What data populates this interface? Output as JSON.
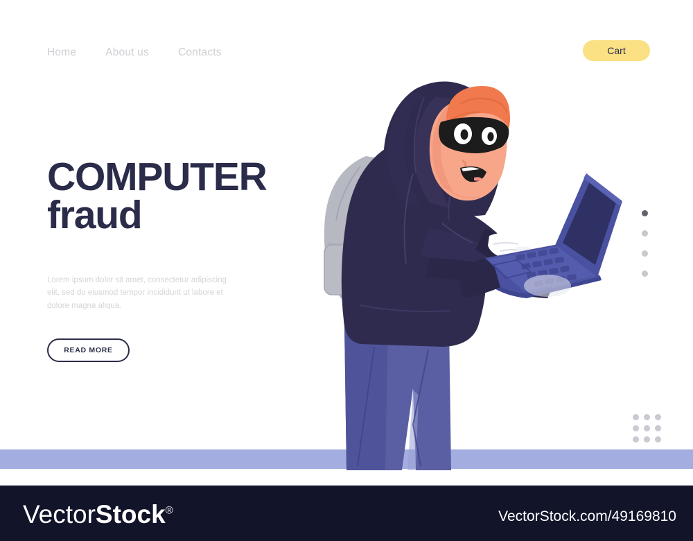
{
  "page": {
    "background_color": "#ffffff",
    "ground_band_color": "#a3addf"
  },
  "nav": {
    "links": [
      {
        "label": "Home"
      },
      {
        "label": "About us"
      },
      {
        "label": "Contacts"
      }
    ],
    "cart": {
      "label": "Cart",
      "background_color": "#fbe084",
      "text_color": "#2b2c4a"
    }
  },
  "hero": {
    "title_line1": "COMPUTER",
    "title_line2": "fraud",
    "title_color": "#2b2c4a",
    "subtitle": "Lorem ipsum dolor sit amet, consectetur adipiscing elit, sed do eiusmod tempor incididunt ut labore et dolore magna aliqua.",
    "subtitle_color": "#d5d5da",
    "cta_label": "READ MORE"
  },
  "decorations": {
    "slider_dots": [
      {
        "state": "active"
      },
      {
        "state": "inactive"
      },
      {
        "state": "inactive"
      },
      {
        "state": "inactive"
      }
    ],
    "dot_grid_count": 9,
    "dot_active_color": "#636370",
    "dot_inactive_color": "#c8c8cd"
  },
  "illustration": {
    "name": "hooded-hacker-with-laptop",
    "colors": {
      "hoodie": "#2f2b4e",
      "hoodie_shade": "#3a3560",
      "pants": "#5a5fa3",
      "pants_shade": "#4d5294",
      "backpack": "#b6b8c2",
      "backpack_shade": "#a6a8b4",
      "skin": "#f7a68a",
      "skin_shade": "#ef8e72",
      "hair": "#f07a4e",
      "mask": "#1c1c1c",
      "laptop_body": "#4a51a0",
      "laptop_screen": "#2f3164",
      "laptop_light": "#6a72bb",
      "glove": "#ffffff",
      "glove_shade": "#e2e3ec"
    }
  },
  "footer": {
    "logo_thin": "Vector",
    "logo_bold": "Stock",
    "logo_registered": "®",
    "url": "VectorStock.com/49169810",
    "background_color": "#12142a"
  }
}
